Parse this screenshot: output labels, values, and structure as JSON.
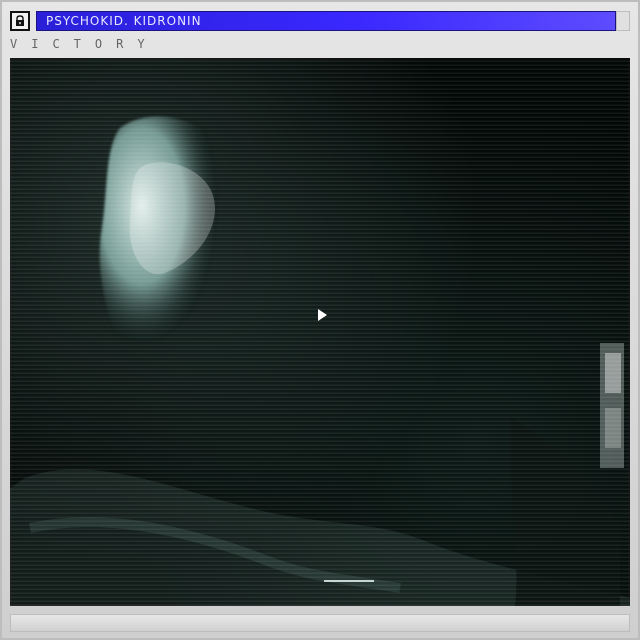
{
  "window": {
    "title": "PSYCHOKID. KIDRONIN",
    "subtitle": "VICTORY"
  },
  "icons": {
    "app": "lock-icon",
    "play": "play-icon"
  },
  "colors": {
    "title_blue": "#3a28ff",
    "screen_bg": "#020806",
    "tint": "#a6d7cf"
  }
}
